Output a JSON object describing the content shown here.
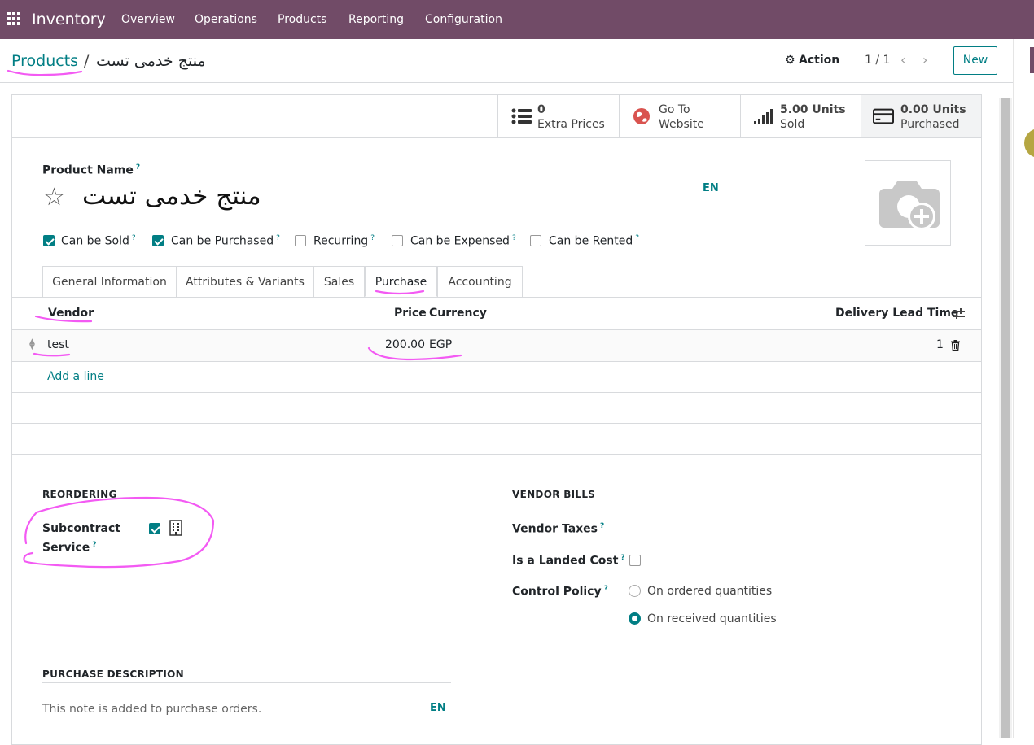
{
  "topbar": {
    "app_name": "Inventory",
    "menu": [
      "Overview",
      "Operations",
      "Products",
      "Reporting",
      "Configuration"
    ]
  },
  "breadcrumb": {
    "parent": "Products",
    "separator": "/",
    "current": "منتج خدمى تست"
  },
  "control": {
    "action_label": "Action",
    "pager": "1 / 1",
    "new_label": "New"
  },
  "stats": [
    {
      "line1": "0",
      "line2": "Extra Prices",
      "icon": "list-icon"
    },
    {
      "line1": "Go To",
      "line2": "Website",
      "icon": "globe-icon"
    },
    {
      "line1": "5.00 Units",
      "line2": "Sold",
      "icon": "signal-icon"
    },
    {
      "line1": "0.00 Units",
      "line2": "Purchased",
      "icon": "credit-card-icon"
    }
  ],
  "product": {
    "name_label": "Product Name",
    "name": "منتج خدمى تست",
    "lang": "EN",
    "help": "?"
  },
  "flags": [
    {
      "label": "Can be Sold",
      "checked": true
    },
    {
      "label": "Can be Purchased",
      "checked": true
    },
    {
      "label": "Recurring",
      "checked": false
    },
    {
      "label": "Can be Expensed",
      "checked": false
    },
    {
      "label": "Can be Rented",
      "checked": false
    }
  ],
  "tabs": [
    "General Information",
    "Attributes & Variants",
    "Sales",
    "Purchase",
    "Accounting"
  ],
  "vendors": {
    "headers": {
      "vendor": "Vendor",
      "price": "Price",
      "currency": "Currency",
      "lead_time": "Delivery Lead Time"
    },
    "rows": [
      {
        "vendor": "test",
        "price": "200.00",
        "currency": "EGP",
        "lead_time": "1"
      }
    ],
    "add_line": "Add a line"
  },
  "reordering": {
    "title": "REORDERING",
    "subcontract_label_1": "Subcontract",
    "subcontract_label_2": "Service",
    "subcontract_checked": true
  },
  "vendor_bills": {
    "title": "VENDOR BILLS",
    "taxes_label": "Vendor Taxes",
    "landed_cost_label": "Is a Landed Cost",
    "landed_cost_checked": false,
    "control_policy_label": "Control Policy",
    "options": [
      "On ordered quantities",
      "On received quantities"
    ],
    "selected_option": "On received quantities"
  },
  "purchase_description": {
    "title": "PURCHASE DESCRIPTION",
    "placeholder": "This note is added to purchase orders.",
    "lang": "EN"
  },
  "colors": {
    "brand": "#714b67",
    "accent": "#017e84",
    "annotation": "#ff00ff"
  }
}
